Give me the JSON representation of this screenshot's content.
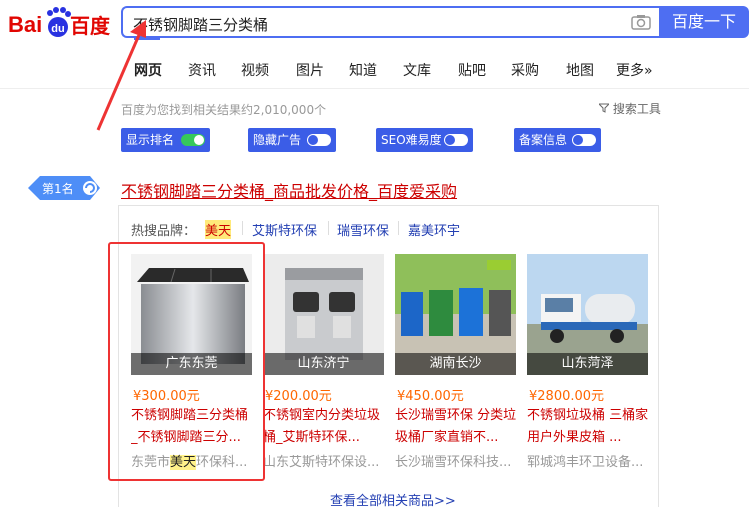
{
  "header": {
    "logo_text": "Bai du 百度",
    "search_value": "不锈钢脚踏三分类桶",
    "search_button": "百度一下"
  },
  "nav": {
    "tabs": [
      "网页",
      "资讯",
      "视频",
      "图片",
      "知道",
      "文库",
      "贴吧",
      "采购",
      "地图",
      "更多»"
    ],
    "active_index": 0
  },
  "results": {
    "count_text": "百度为您找到相关结果约2,010,000个",
    "tools_label": "搜索工具"
  },
  "toggles": [
    {
      "label": "显示排名",
      "on": true
    },
    {
      "label": "隐藏广告",
      "on": false
    },
    {
      "label": "SEO难易度",
      "on": false
    },
    {
      "label": "备案信息",
      "on": false
    }
  ],
  "rank_badge": "第1名",
  "result": {
    "title": "不锈钢脚踏三分类桶_商品批发价格_百度爱采购",
    "hot_brands_label": "热搜品牌：",
    "brands": [
      "美天",
      "艾斯特环保",
      "瑞雪环保",
      "嘉美环宇"
    ],
    "view_all": "查看全部相关商品>>",
    "products": [
      {
        "location": "广东东莞",
        "price": "¥300.00元",
        "desc1": "不锈钢脚踏三分类桶",
        "desc2": "_不锈钢脚踏三分...",
        "seller_pre": "东莞市",
        "seller_hl": "美天",
        "seller_post": "环保科..."
      },
      {
        "location": "山东济宁",
        "price": "¥200.00元",
        "desc1": "不锈钢室内分类垃圾",
        "desc2": "桶_艾斯特环保...",
        "seller_pre": "山东艾斯特环保设...",
        "seller_hl": "",
        "seller_post": ""
      },
      {
        "location": "湖南长沙",
        "price": "¥450.00元",
        "desc1": "长沙瑞雪环保 分类垃",
        "desc2": "圾桶厂家直销不...",
        "seller_pre": "长沙瑞雪环保科技...",
        "seller_hl": "",
        "seller_post": ""
      },
      {
        "location": "山东菏泽",
        "price": "¥2800.00元",
        "desc1": "不锈钢垃圾桶 三桶家",
        "desc2": "用户外果皮箱 ...",
        "seller_pre": "郓城鸿丰环卫设备...",
        "seller_hl": "",
        "seller_post": ""
      }
    ]
  },
  "colors": {
    "accent": "#4e6ef2",
    "title_red": "#cc0000",
    "price_orange": "#ff6600",
    "annotation_red": "#ee3333"
  }
}
